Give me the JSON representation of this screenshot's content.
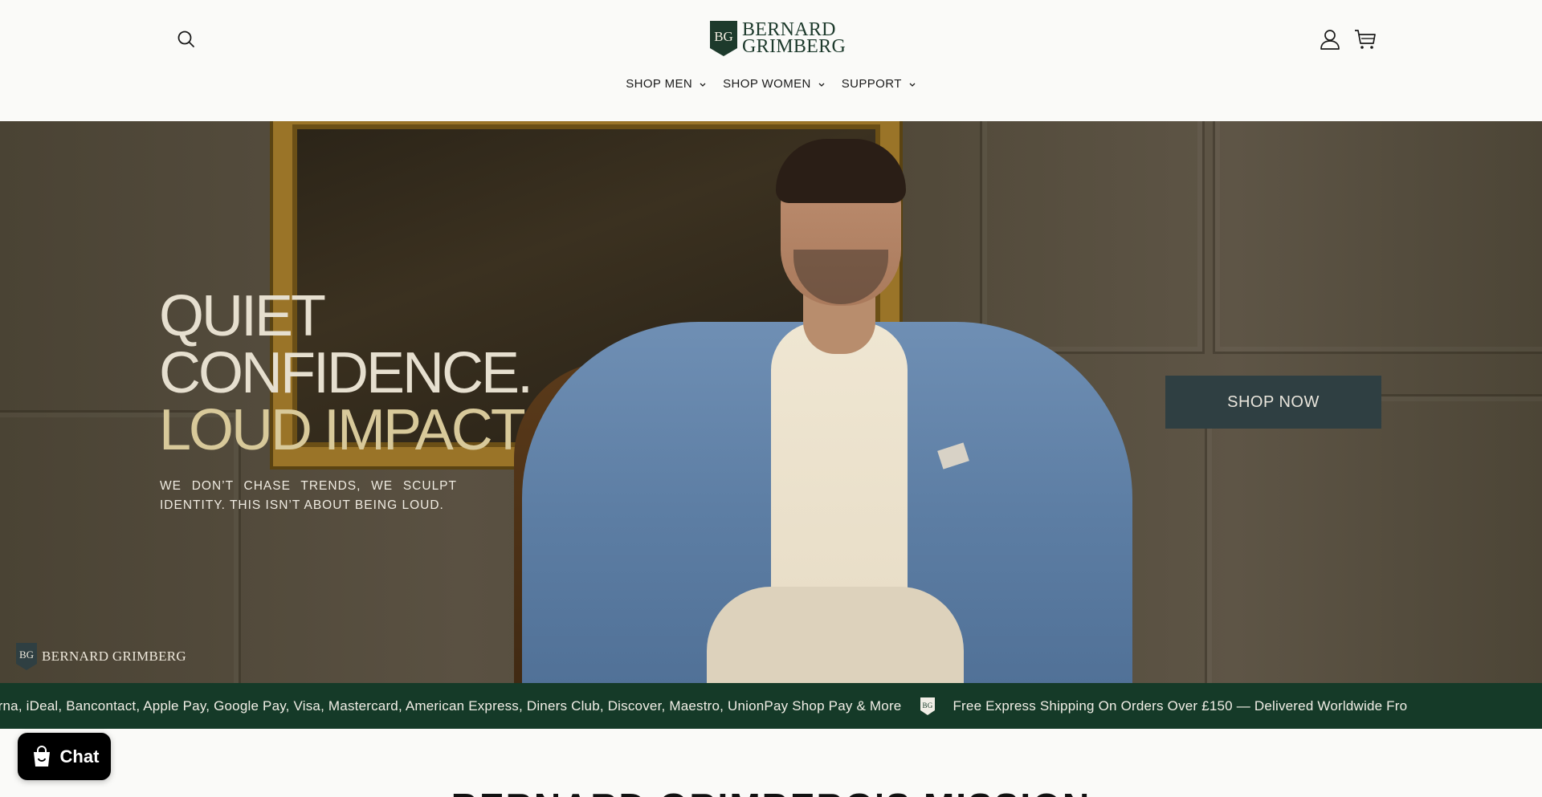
{
  "header": {
    "search_icon": "search-icon",
    "logo": {
      "line1": "BERNARD",
      "line2": "GRIMBERG",
      "monogram": "BG"
    },
    "account_icon": "user-icon",
    "cart_icon": "cart-icon"
  },
  "nav": {
    "items": [
      {
        "label": "SHOP MEN"
      },
      {
        "label": "SHOP WOMEN"
      },
      {
        "label": "SUPPORT"
      }
    ]
  },
  "hero": {
    "headline_line1": "QUIET",
    "headline_line2": "CONFIDENCE.",
    "headline_line3": "LOUD IMPACT",
    "subtitle": "WE DON’T CHASE TRENDS, WE SCULPT IDENTITY. THIS ISN’T ABOUT BEING LOUD.",
    "cta_label": "SHOP NOW",
    "brand_text": "BERNARD GRIMBERG",
    "brand_monogram": "BG"
  },
  "marquee": {
    "text1": "arna, iDeal, Bancontact, Apple Pay, Google Pay, Visa, Mastercard, American Express, Diners Club, Discover, Maestro, UnionPay Shop Pay & More",
    "text2": "Free Express Shipping On Orders Over £150 — Delivered Worldwide Fro"
  },
  "section": {
    "mission_title": "BERNARD GRIMBERG'S MISSION"
  },
  "chat": {
    "label": "Chat"
  },
  "colors": {
    "brand_green": "#153a28",
    "cta_bg": "#2f3f42",
    "headline_accent": "#d8c99a"
  }
}
